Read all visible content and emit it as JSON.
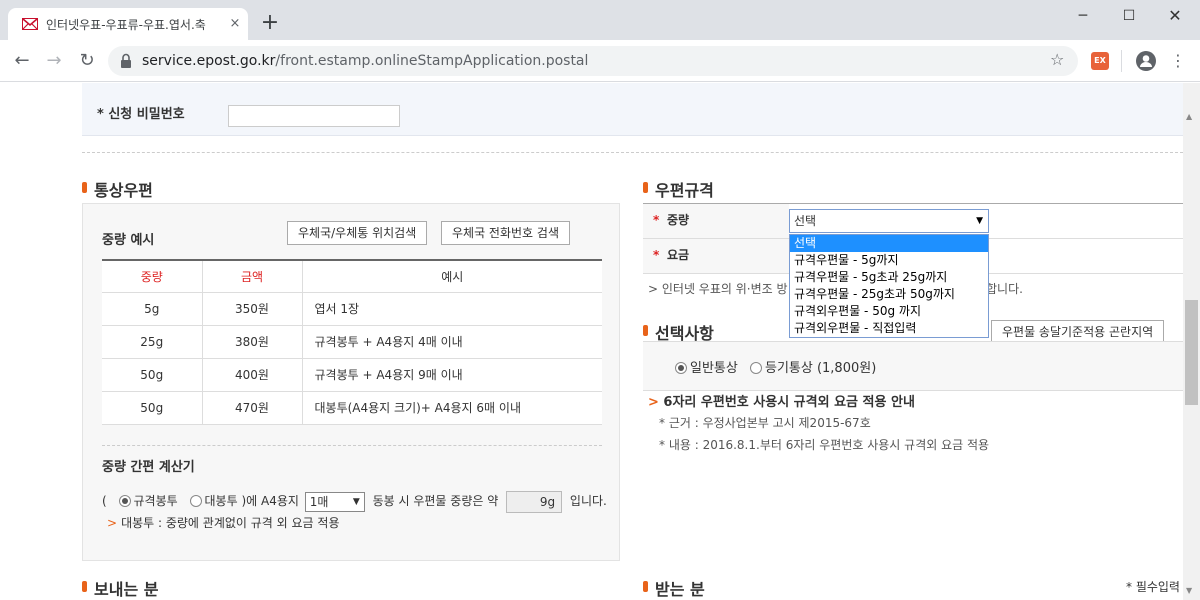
{
  "browser": {
    "tab_title": "인터넷우표-우표류-우표.엽서.축",
    "tab_close": "×",
    "new_tab": "+",
    "url_host": "service.epost.go.kr",
    "url_path": "/front.estamp.onlineStampApplication.postal",
    "ext_label": "EX",
    "window_min": "─",
    "window_max": "☐",
    "window_close": "✕"
  },
  "password_row": {
    "label": "* 신청 비밀번호"
  },
  "left_section": {
    "title": "통상우편",
    "subtitle": "중량 예시",
    "btn_location": "우체국/우체통 위치검색",
    "btn_phone": "우체국 전화번호 검색",
    "table": {
      "headers": [
        "중량",
        "금액",
        "예시"
      ],
      "rows": [
        [
          "5g",
          "350원",
          "엽서 1장"
        ],
        [
          "25g",
          "380원",
          "규격봉투 + A4용지 4매 이내"
        ],
        [
          "50g",
          "400원",
          "규격봉투 + A4용지 9매 이내"
        ],
        [
          "50g",
          "470원",
          "대봉투(A4용지 크기)+ A4용지 6매 이내"
        ]
      ]
    },
    "calc": {
      "title": "중량 간편 계산기",
      "open_paren": "(",
      "radio_standard": "규격봉투",
      "radio_large": "대봉투",
      "middle_text": ")에 A4용지",
      "sheet_select": "1매",
      "after_select": "동봉 시 우편물 중량은 약",
      "weight_value": "9g",
      "tail": "입니다.",
      "note_mark": ">",
      "note": "대봉투 : 중량에 관계없이 규격 외 요금 적용"
    }
  },
  "right_section": {
    "title": "우편규격",
    "weight_label": "중량",
    "fee_label": "요금",
    "required_mark": "*",
    "weight_select_value": "선택",
    "dropdown_options": [
      "선택",
      "규격우편물 - 5g까지",
      "규격우편물 - 5g초과 25g까지",
      "규격우편물 - 25g초과 50g까지",
      "규격외우편물 - 50g 까지",
      "규격외우편물 - 직접입력"
    ],
    "note_prefix": "> 인터넷 우표의 위·변조 방",
    "note_suffix": "합니다.",
    "options_title": "선택사항",
    "options_btn": "우편물 송달기준적용 곤란지역",
    "radio_normal": "일반통상",
    "radio_registered": "등기통상 (1,800원)",
    "info_head": "6자리 우편번호 사용시 규격외 요금 적용 안내",
    "info_basis": "* 근거 : 우정사업본부 고시 제2015-67호",
    "info_content": "* 내용 : 2016.8.1.부터 6자리 우편번호 사용시 규격외 요금 적용"
  },
  "bottom": {
    "sender_title": "보내는 분",
    "receiver_title": "받는 분",
    "required_note": "* 필수입력"
  },
  "colors": {
    "accent": "#e8631a",
    "required": "#dd2222",
    "dropdown_highlight": "#1e90ff"
  }
}
